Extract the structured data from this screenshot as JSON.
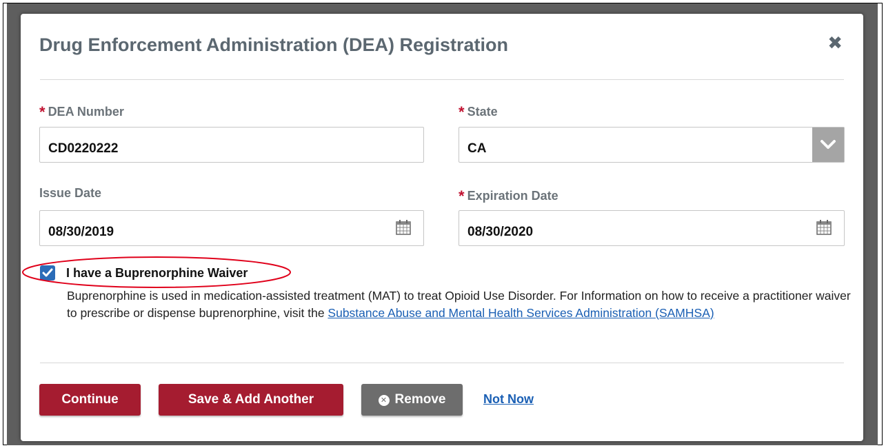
{
  "dialog": {
    "title": "Drug Enforcement Administration (DEA) Registration",
    "close_glyph": "✖"
  },
  "form": {
    "dea_number": {
      "label": "DEA Number",
      "required_mark": "*",
      "value": "CD0220222"
    },
    "state": {
      "label": "State",
      "required_mark": "*",
      "value": "CA"
    },
    "issue_date": {
      "label": "Issue Date",
      "value": "08/30/2019"
    },
    "expiration_date": {
      "label": "Expiration Date",
      "required_mark": "*",
      "value": "08/30/2020"
    }
  },
  "waiver": {
    "checked": true,
    "label": "I have a Buprenorphine Waiver",
    "description": "Buprenorphine is used in medication-assisted treatment (MAT) to treat Opioid Use Disorder. For Information on how to receive a practitioner waiver to prescribe or dispense buprenorphine, visit the ",
    "link_text": "Substance Abuse and Mental Health Services Administration (SAMHSA)"
  },
  "buttons": {
    "continue": "Continue",
    "save_add": "Save & Add Another",
    "remove": "Remove",
    "not_now": "Not Now"
  },
  "colors": {
    "primary_button": "#a51c30",
    "required_star": "#c0102f",
    "link": "#1a5fb4",
    "checkbox": "#2b6cb8",
    "annotation_ellipse": "#e0001a"
  }
}
